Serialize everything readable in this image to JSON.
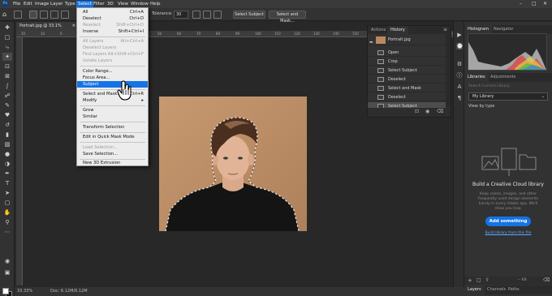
{
  "menubar": {
    "logo": "Ps",
    "items": [
      "File",
      "Edit",
      "Image",
      "Layer",
      "Type",
      "Select",
      "Filter",
      "3D",
      "View",
      "Window",
      "Help"
    ],
    "active": "Select"
  },
  "options_bar": {
    "tolerance_label": "Tolerance:",
    "tolerance_value": "30",
    "select_subject": "Select Subject",
    "select_and_mask": "Select and Mask..."
  },
  "document": {
    "tab_title": "Portrait.jpg @ 33.1% (RGB/8) *",
    "ruler_ticks": [
      "20",
      "10",
      "0",
      "10",
      "20",
      "30",
      "40",
      "50",
      "60",
      "70",
      "80",
      "90",
      "100",
      "110",
      "120",
      "130",
      "140",
      "150",
      "160",
      "170",
      "180",
      "190",
      "200"
    ]
  },
  "status_bar": {
    "zoom": "33.33%",
    "doc": "Doc: 6.12M/6.12M"
  },
  "select_menu": {
    "items": [
      {
        "label": "All",
        "shortcut": "Ctrl+A",
        "disabled": false
      },
      {
        "label": "Deselect",
        "shortcut": "Ctrl+D",
        "disabled": false
      },
      {
        "label": "Reselect",
        "shortcut": "Shift+Ctrl+D",
        "disabled": true
      },
      {
        "label": "Inverse",
        "shortcut": "Shift+Ctrl+I",
        "disabled": false
      },
      {
        "label": "All Layers",
        "shortcut": "Alt+Ctrl+A",
        "disabled": true
      },
      {
        "label": "Deselect Layers",
        "shortcut": "",
        "disabled": true
      },
      {
        "label": "Find Layers",
        "shortcut": "Alt+Shift+Ctrl+F",
        "disabled": true
      },
      {
        "label": "Isolate Layers",
        "shortcut": "",
        "disabled": true
      },
      {
        "label": "Color Range...",
        "shortcut": "",
        "disabled": false
      },
      {
        "label": "Focus Area...",
        "shortcut": "",
        "disabled": false
      },
      {
        "label": "Subject",
        "shortcut": "",
        "disabled": false,
        "highlighted": true
      },
      {
        "label": "Select and Mask...",
        "shortcut": "Alt+Ctrl+R",
        "disabled": false
      },
      {
        "label": "Modify",
        "shortcut": "",
        "disabled": false
      },
      {
        "label": "Grow",
        "shortcut": "",
        "disabled": false
      },
      {
        "label": "Similar",
        "shortcut": "",
        "disabled": false
      },
      {
        "label": "Transform Selection",
        "shortcut": "",
        "disabled": false
      },
      {
        "label": "Edit in Quick Mask Mode",
        "shortcut": "",
        "disabled": false
      },
      {
        "label": "Load Selection...",
        "shortcut": "",
        "disabled": true
      },
      {
        "label": "Save Selection...",
        "shortcut": "",
        "disabled": false
      },
      {
        "label": "New 3D Extrusion",
        "shortcut": "",
        "disabled": false
      }
    ]
  },
  "history_panel": {
    "tabs": [
      "Actions",
      "History"
    ],
    "active_tab": "History",
    "snapshot": "Portrait.jpg",
    "steps": [
      "Open",
      "Crop",
      "Select Subject",
      "Deselect",
      "Select and Mask",
      "Deselect",
      "Select Subject"
    ],
    "selected_step": 6
  },
  "histogram_panel": {
    "tabs": [
      "Histogram",
      "Navigator"
    ],
    "active_tab": "Histogram"
  },
  "libraries_panel": {
    "tabs": [
      "Libraries",
      "Adjustments"
    ],
    "active_tab": "Libraries",
    "search_placeholder": "Search Current Library",
    "library_name": "My Library",
    "view_by": "View by type",
    "empty_title": "Build a Creative Cloud library",
    "empty_desc": "Keep colors, images, and other frequently used design elements handy in every Adobe app. We'll show you how.",
    "add_button": "Add something",
    "link": "Build library from this file",
    "size": "-- KB"
  },
  "layers_panel": {
    "tabs": [
      "Layers",
      "Channels",
      "Paths"
    ],
    "active_tab": "Layers"
  },
  "colors": {
    "accent": "#1473e6",
    "panel": "#323232",
    "canvas": "#282828",
    "menu_bg": "#ececec"
  }
}
